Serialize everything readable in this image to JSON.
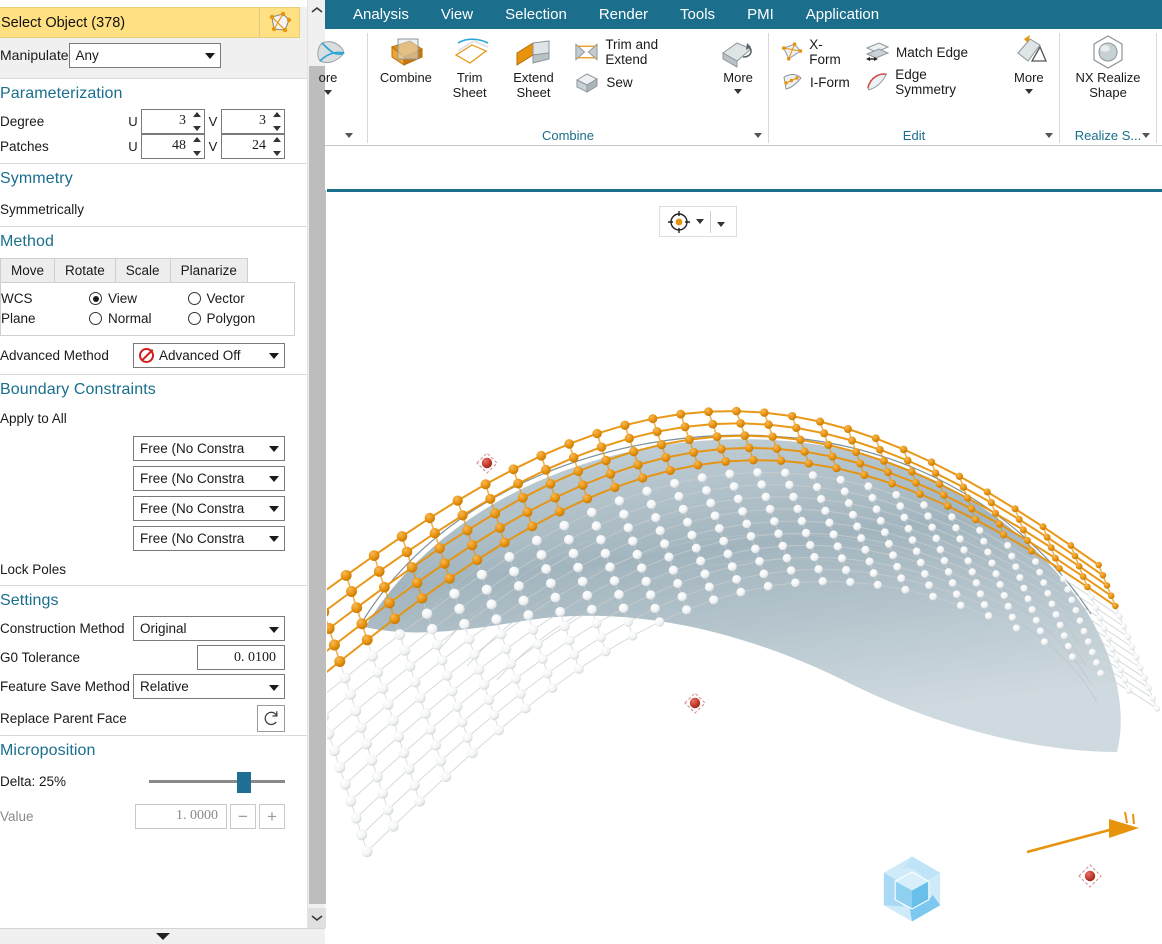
{
  "menubar": {
    "items": [
      {
        "label": "Analysis"
      },
      {
        "label": "View"
      },
      {
        "label": "Selection"
      },
      {
        "label": "Render"
      },
      {
        "label": "Tools"
      },
      {
        "label": "PMI"
      },
      {
        "label": "Application"
      }
    ]
  },
  "ribbon": {
    "groups": [
      {
        "name": "surface-more-group",
        "title": "",
        "buttons": [
          {
            "label": "ore",
            "icon": "surface-icon"
          }
        ]
      },
      {
        "name": "combine-group",
        "title": "Combine",
        "big_buttons": [
          {
            "label": "Combine",
            "icon": "combine-icon"
          },
          {
            "label": "Trim Sheet",
            "icon": "trim-sheet-icon"
          },
          {
            "label": "Extend Sheet",
            "icon": "extend-sheet-icon"
          }
        ],
        "small_buttons": [
          {
            "label": "Trim and Extend",
            "icon": "trim-and-extend-icon"
          },
          {
            "label": "Sew",
            "icon": "sew-icon"
          }
        ],
        "more": {
          "label": "More",
          "icon": "more-combine-icon"
        }
      },
      {
        "name": "edit-group",
        "title": "Edit",
        "small_buttons": [
          {
            "label": "X-Form",
            "icon": "x-form-icon"
          },
          {
            "label": "Match Edge",
            "icon": "match-edge-icon"
          },
          {
            "label": "I-Form",
            "icon": "i-form-icon"
          },
          {
            "label": "Edge Symmetry",
            "icon": "edge-symmetry-icon"
          }
        ],
        "more": {
          "label": "More",
          "icon": "more-edit-icon"
        }
      },
      {
        "name": "realize-shape-group",
        "title": "Realize S...",
        "big_buttons": [
          {
            "label": "NX Realize Shape",
            "icon": "nx-realize-shape-icon"
          }
        ]
      }
    ]
  },
  "dialog": {
    "select_object": {
      "label": "Select Object (378)",
      "icon": "select-object-icon"
    },
    "manipulate": {
      "label": "Manipulate",
      "value": "Any"
    },
    "parameterization": {
      "title": "Parameterization",
      "rows": [
        {
          "label": "Degree",
          "u_label": "U",
          "u_value": "3",
          "v_label": "V",
          "v_value": "3"
        },
        {
          "label": "Patches",
          "u_label": "U",
          "u_value": "48",
          "v_label": "V",
          "v_value": "24"
        }
      ]
    },
    "symmetry": {
      "title": "Symmetry",
      "checkbox_label": "Symmetrically"
    },
    "method": {
      "title": "Method",
      "tabs": [
        "Move",
        "Rotate",
        "Scale",
        "Planarize"
      ],
      "active_tab": "Move",
      "radio_rows": [
        {
          "label": "WCS",
          "options": [
            {
              "label": "View",
              "selected": true
            },
            {
              "label": "Vector",
              "selected": false
            }
          ]
        },
        {
          "label": "Plane",
          "options": [
            {
              "label": "Normal",
              "selected": false
            },
            {
              "label": "Polygon",
              "selected": false
            }
          ]
        }
      ],
      "advanced_method_label": "Advanced Method",
      "advanced_method_value": "Advanced Off",
      "advanced_method_icon": "no-entry-icon"
    },
    "boundary_constraints": {
      "title": "Boundary Constraints",
      "apply_all_label": "Apply to All",
      "constraints": [
        {
          "value": "Free (No Constra"
        },
        {
          "value": "Free (No Constra"
        },
        {
          "value": "Free (No Constra"
        },
        {
          "value": "Free (No Constra"
        }
      ],
      "lock_poles_label": "Lock Poles"
    },
    "settings": {
      "title": "Settings",
      "rows": [
        {
          "label": "Construction Method",
          "value": "Original",
          "type": "combo"
        },
        {
          "label": "G0 Tolerance",
          "value": "0. 0100",
          "type": "number"
        },
        {
          "label": "Feature Save Method",
          "value": "Relative",
          "type": "combo"
        },
        {
          "label": "Replace Parent Face",
          "value": "",
          "type": "button",
          "icon": "reset-icon"
        }
      ]
    },
    "microposition": {
      "title": "Microposition",
      "delta_label": "Delta: 25%",
      "value_label": "Value",
      "value": "1. 0000",
      "slider_percent": 65,
      "minus_label": "−",
      "plus_label": "+"
    },
    "scrollbar": {
      "up_icon": "chevron-up-icon",
      "down_icon": "chevron-down-icon"
    },
    "collapse_icon": "chevron-down-icon"
  },
  "viewport": {
    "float_toolbar": {
      "snap_point_icon": "snap-point-icon",
      "dropdown_icon": "chevron-down-icon",
      "overflow_icon": "chevron-down-icon"
    },
    "logo": {
      "name": "nx-realize-shape-logo"
    },
    "model": {
      "name": "nurbs-surface-with-poles",
      "selected_pole_color": "#e8930c",
      "pole_color": "#ffffff",
      "surface_color": "#aebfc7",
      "handle_color": "#c0392b"
    }
  },
  "colors": {
    "accent_teal": "#1b6e8c",
    "highlight_yellow": "#ffe082",
    "orange": "#e8930c",
    "red": "#c0392b"
  }
}
